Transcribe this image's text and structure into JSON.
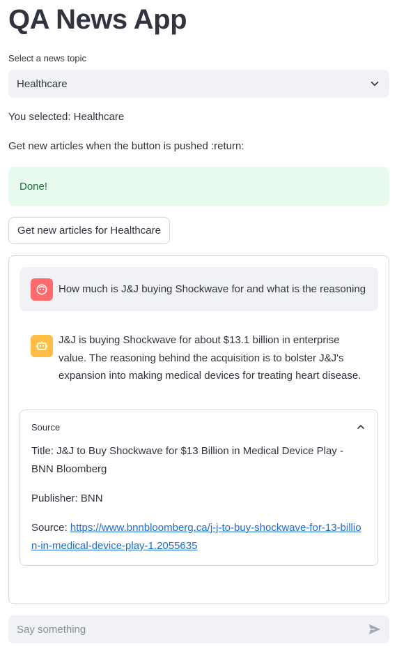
{
  "app": {
    "title": "QA News App"
  },
  "topic": {
    "label": "Select a news topic",
    "selected": "Healthcare"
  },
  "status": {
    "selected_text": "You selected: Healthcare",
    "instruction": "Get new articles when the button is pushed :return:",
    "done": "Done!"
  },
  "button": {
    "label": "Get new articles for Healthcare"
  },
  "chat": {
    "user_message": "How much is J&J buying Shockwave for and what is the reasoning",
    "bot_message": "J&J is buying Shockwave for about $13.1 billion in enterprise value. The reasoning behind the acquisition is to bolster J&J's expansion into making medical devices for treating heart disease.",
    "source": {
      "header": "Source",
      "title_line": "Title: J&J to Buy Shockwave for $13 Billion in Medical Device Play - BNN Bloomberg",
      "publisher_line": "Publisher: BNN",
      "source_prefix": "Source: ",
      "url": "https://www.bnnbloomberg.ca/j-j-to-buy-shockwave-for-13-billion-in-medical-device-play-1.2055635"
    }
  },
  "input": {
    "placeholder": "Say something"
  },
  "colors": {
    "user_avatar": "#ff6b6b",
    "bot_avatar": "#ffbd45",
    "success_bg": "#e8f9ee",
    "success_text": "#177233",
    "link": "#1c6ecf"
  },
  "icons": {
    "user": "user-face-icon",
    "bot": "robot-icon",
    "send": "send-icon",
    "dropdown": "chevron-down-icon",
    "collapse": "chevron-up-icon"
  }
}
